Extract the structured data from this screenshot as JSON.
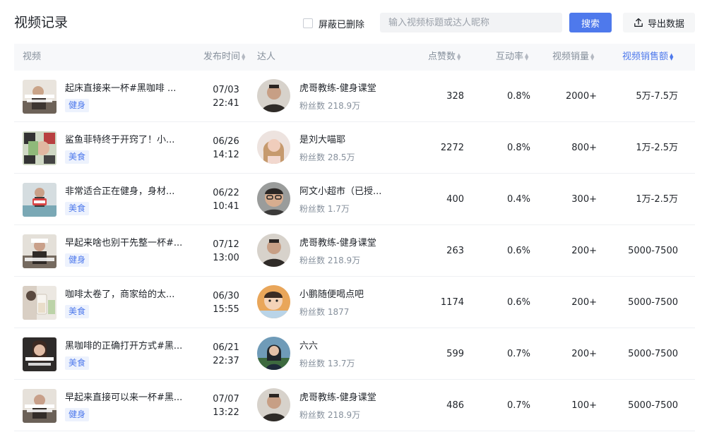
{
  "page": {
    "title": "视频记录",
    "hide_deleted_label": "屏蔽已删除",
    "search_placeholder": "输入视频标题或达人昵称",
    "search_label": "搜索",
    "export_label": "导出数据"
  },
  "columns": {
    "video": "视频",
    "publish_time": "发布时间",
    "influencer": "达人",
    "likes": "点赞数",
    "engagement": "互动率",
    "sales": "视频销量",
    "revenue": "视频销售额"
  },
  "colors": {
    "accent": "#4e79ec",
    "tag_bg": "#edf2fd",
    "header_bg": "#f7f8fa",
    "muted_text": "#86909c"
  },
  "rows": [
    {
      "title": "起床直接来一杯#黑咖啡 ...",
      "tag": "健身",
      "date": "07/03",
      "time": "22:41",
      "author": "虎哥教练-健身课堂",
      "fans": "粉丝数 218.9万",
      "likes": "328",
      "rate": "0.8%",
      "sales": "2000+",
      "amount": "5万-7.5万"
    },
    {
      "title": "鲨鱼菲特终于开窍了！小...",
      "tag": "美食",
      "date": "06/26",
      "time": "14:12",
      "author": "是刘大喵耶",
      "fans": "粉丝数 28.5万",
      "likes": "2272",
      "rate": "0.8%",
      "sales": "800+",
      "amount": "1万-2.5万"
    },
    {
      "title": "非常适合正在健身，身材...",
      "tag": "美食",
      "date": "06/22",
      "time": "10:41",
      "author": "阿文小超市（已授...",
      "fans": "粉丝数 1.7万",
      "likes": "400",
      "rate": "0.4%",
      "sales": "300+",
      "amount": "1万-2.5万"
    },
    {
      "title": "早起来啥也别干先整一杯#...",
      "tag": "健身",
      "date": "07/12",
      "time": "13:00",
      "author": "虎哥教练-健身课堂",
      "fans": "粉丝数 218.9万",
      "likes": "263",
      "rate": "0.6%",
      "sales": "200+",
      "amount": "5000-7500"
    },
    {
      "title": "咖啡太卷了，商家给的太...",
      "tag": "美食",
      "date": "06/30",
      "time": "15:55",
      "author": "小鹏随便喝点吧",
      "fans": "粉丝数 1877",
      "likes": "1174",
      "rate": "0.6%",
      "sales": "200+",
      "amount": "5000-7500"
    },
    {
      "title": "黑咖啡的正确打开方式#黑...",
      "tag": "美食",
      "date": "06/21",
      "time": "22:37",
      "author": "六六",
      "fans": "粉丝数 13.7万",
      "likes": "599",
      "rate": "0.7%",
      "sales": "200+",
      "amount": "5000-7500"
    },
    {
      "title": "早起来直接可以来一杯#黑...",
      "tag": "健身",
      "date": "07/07",
      "time": "13:22",
      "author": "虎哥教练-健身课堂",
      "fans": "粉丝数 218.9万",
      "likes": "486",
      "rate": "0.7%",
      "sales": "100+",
      "amount": "5000-7500"
    }
  ]
}
